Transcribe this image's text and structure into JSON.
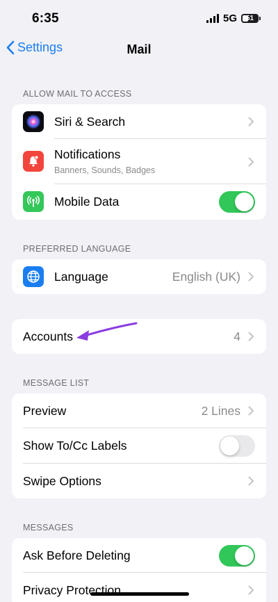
{
  "status_bar": {
    "time": "6:35",
    "network": "5G",
    "battery": "51"
  },
  "nav": {
    "back_label": "Settings",
    "title": "Mail"
  },
  "sections": {
    "allow_access": {
      "header": "ALLOW MAIL TO ACCESS",
      "siri_label": "Siri & Search",
      "notifications_label": "Notifications",
      "notifications_sub": "Banners, Sounds, Badges",
      "mobile_data_label": "Mobile Data",
      "mobile_data_on": true
    },
    "preferred_language": {
      "header": "PREFERRED LANGUAGE",
      "language_label": "Language",
      "language_value": "English (UK)"
    },
    "accounts": {
      "label": "Accounts",
      "value": "4"
    },
    "message_list": {
      "header": "MESSAGE LIST",
      "preview_label": "Preview",
      "preview_value": "2 Lines",
      "show_tocc_label": "Show To/Cc Labels",
      "show_tocc_on": false,
      "swipe_label": "Swipe Options"
    },
    "messages": {
      "header": "MESSAGES",
      "ask_delete_label": "Ask Before Deleting",
      "ask_delete_on": true,
      "privacy_label": "Privacy Protection"
    }
  },
  "colors": {
    "accent": "#1a7ef0",
    "toggle_on": "#32c759",
    "annotation_arrow": "#8a3ce0"
  },
  "icons": {
    "siri": "siri-icon",
    "notifications": "notifications-bell-icon",
    "mobile_data": "antenna-icon",
    "language": "globe-icon"
  }
}
